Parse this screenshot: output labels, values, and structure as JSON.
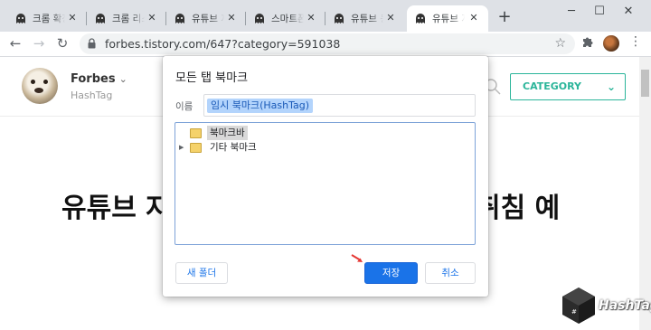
{
  "tabs": [
    {
      "title": "크롬 확장"
    },
    {
      "title": "크롬 리소"
    },
    {
      "title": "유튜브 재"
    },
    {
      "title": "스마트폰"
    },
    {
      "title": "유튜브 동"
    },
    {
      "title": "유튜브 자",
      "active": true
    }
  ],
  "toolbar": {
    "url": "forbes.tistory.com/647?category=591038"
  },
  "blog": {
    "name": "Forbes",
    "subtitle": "HashTag",
    "category_label": "CATEGORY",
    "post_title_start": "유튜브 자",
    "post_title_end": "취침 예"
  },
  "dialog": {
    "title": "모든 탭 북마크",
    "name_label": "이름",
    "name_value": "임시 북마크(HashTag)",
    "folders": [
      {
        "label": "북마크바",
        "selected": true,
        "expandable": false
      },
      {
        "label": "기타 북마크",
        "selected": false,
        "expandable": true
      }
    ],
    "new_folder_label": "새 폴더",
    "save_label": "저장",
    "cancel_label": "취소"
  },
  "watermark": {
    "text": "HashTag"
  },
  "colors": {
    "accent": "#1a73e8",
    "category_border": "#2bb59a",
    "tabstrip": "#dee1e6"
  },
  "icons": {
    "favicon": "ghost-favicon-icon",
    "tab_close": "close-icon",
    "new_tab": "plus-icon",
    "back": "back-arrow-icon",
    "forward": "forward-arrow-icon",
    "reload": "reload-icon",
    "lock": "lock-icon",
    "bookmark": "star-icon",
    "extensions": "puzzle-icon",
    "menu": "kebab-menu-icon",
    "search": "search-icon"
  }
}
